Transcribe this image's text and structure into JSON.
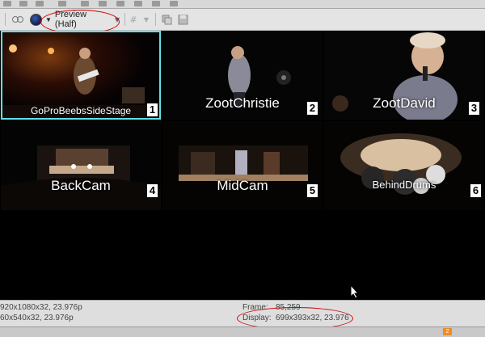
{
  "toolbar": {
    "preview_label": "Preview (Half)",
    "icons": [
      "split-screen-icon",
      "overlay-icon",
      "external-monitor-icon",
      "circle-icon",
      "grid-icon",
      "copy-snapshot-icon",
      "save-snapshot-icon"
    ]
  },
  "tiles": [
    {
      "label": "GoProBeebsSideStage",
      "number": "1"
    },
    {
      "label": "ZootChristie",
      "number": "2"
    },
    {
      "label": "ZootDavid",
      "number": "3"
    },
    {
      "label": "BackCam",
      "number": "4"
    },
    {
      "label": "MidCam",
      "number": "5"
    },
    {
      "label": "BehindDrums",
      "number": "6"
    }
  ],
  "status": {
    "project_left": "920x1080x32, 23.976p",
    "preview_left": "60x540x32, 23.976p",
    "frame_label": "Frame:",
    "frame_value": "85,259",
    "display_label": "Display:",
    "display_value": "699x393x32, 23.976"
  },
  "bottom_badge": "2",
  "colors": {
    "selected_outline": "#5fe1e8",
    "annotation_red": "#d20000",
    "badge_orange": "#f08a24"
  }
}
